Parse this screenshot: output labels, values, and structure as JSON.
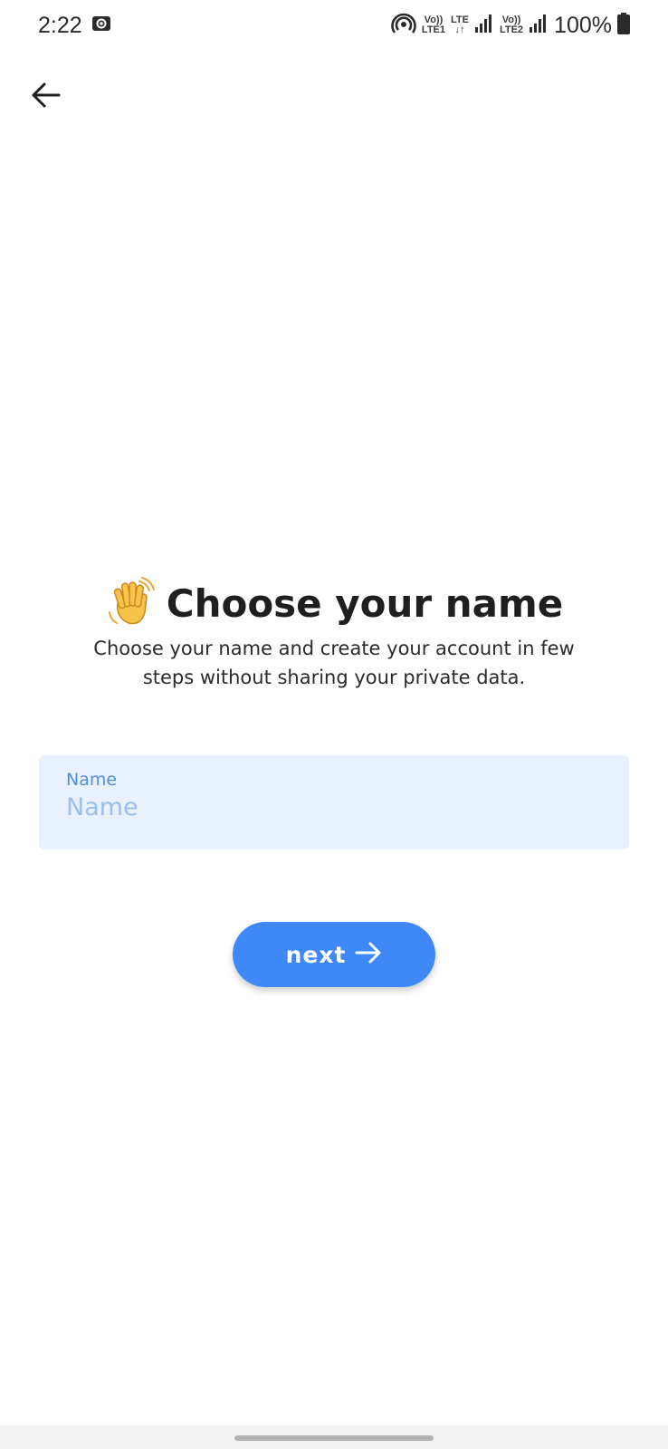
{
  "status_bar": {
    "time": "2:22",
    "sim1_top": "Vo))",
    "sim1_bottom": "LTE1",
    "lte_top": "LTE",
    "lte_bottom": "↓↑",
    "sim2_top": "Vo))",
    "sim2_bottom": "LTE2",
    "battery": "100%"
  },
  "header": {
    "back_icon": "arrow-left-icon"
  },
  "main": {
    "wave_icon": "waving-hand-icon",
    "title": "Choose your name",
    "subtitle": "Choose your name and create your account in few steps without sharing your private data."
  },
  "form": {
    "name_label": "Name",
    "name_placeholder": "Name",
    "name_value": ""
  },
  "actions": {
    "next_label": "next",
    "next_icon": "arrow-right-icon"
  },
  "colors": {
    "accent": "#3f88f7",
    "field_bg": "#e8f1fc",
    "label": "#4f8fe0"
  }
}
